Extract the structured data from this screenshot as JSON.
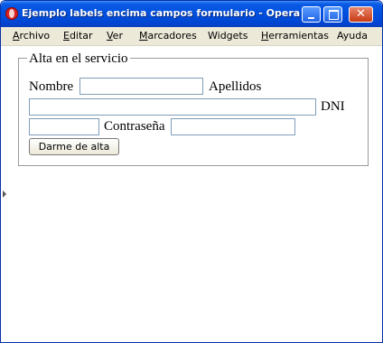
{
  "window": {
    "title": "Ejemplo labels encima campos formulario - Opera",
    "controls": {
      "minimize": "_",
      "maximize": "□",
      "close": "✕"
    }
  },
  "menubar": {
    "items": [
      {
        "label": "Archivo",
        "accel": "A",
        "rest": "rchivo"
      },
      {
        "label": "Editar",
        "accel": "E",
        "rest": "ditar"
      },
      {
        "label": "Ver",
        "accel": "V",
        "rest": "er"
      },
      {
        "label": "Marcadores",
        "accel": "M",
        "rest": "arcadores"
      },
      {
        "label": "Widgets",
        "accel": "",
        "rest": "Widgets"
      },
      {
        "label": "Herramientas",
        "accel": "H",
        "rest": "erramientas"
      },
      {
        "label": "Ayuda",
        "accel": "",
        "rest": "Ayuda"
      }
    ]
  },
  "form": {
    "legend": "Alta en el servicio",
    "nombre_label": "Nombre",
    "nombre_value": "",
    "apellidos_label": "Apellidos",
    "apellidos_value": "",
    "dni_label": "DNI",
    "dni_value": "",
    "contrasena_label": "Contraseña",
    "contrasena_value": "",
    "submit_label": "Darme de alta"
  },
  "icons": {
    "app": "opera-icon",
    "minimize": "minimize-icon",
    "maximize": "maximize-icon",
    "close": "close-icon"
  },
  "colors": {
    "titlebar": "#0050e0",
    "menubar": "#ece9d8",
    "close_button": "#c63a14",
    "input_border": "#7f9db9"
  }
}
